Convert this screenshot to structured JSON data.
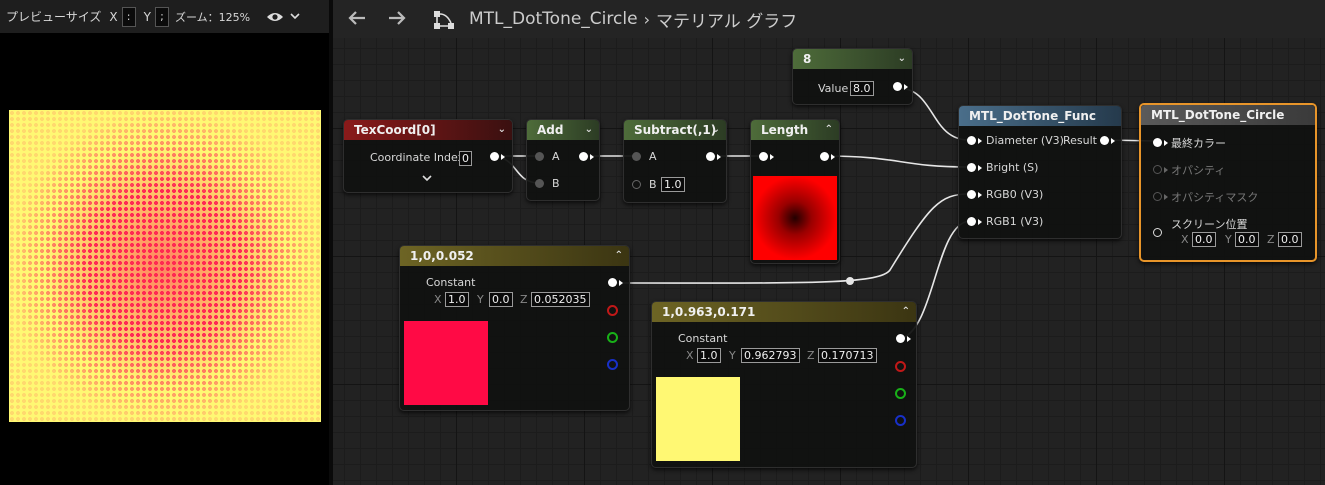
{
  "preview": {
    "label": "プレビューサイズ",
    "x_label": "X",
    "x_value": ":",
    "y_label": "Y",
    "y_value": ";",
    "zoom": "ズーム：125%"
  },
  "graph_header": {
    "asset": "MTL_DotTone_Circle",
    "separator": "›",
    "page": "マテリアル グラフ"
  },
  "nodes": {
    "texcoord": {
      "title": "TexCoord[0]",
      "label": "Coordinate Index",
      "value": "0"
    },
    "add": {
      "title": "Add",
      "pin_a": "A",
      "pin_b": "B"
    },
    "subtract": {
      "title": "Subtract(,1)",
      "pin_a": "A",
      "pin_b": "B",
      "b_value": "1.0"
    },
    "length": {
      "title": "Length"
    },
    "scalar": {
      "title": "8",
      "label": "Value",
      "value": "8.0"
    },
    "func": {
      "title": "MTL_DotTone_Func",
      "in1": "Diameter (V3)",
      "in2": "Bright (S)",
      "in3": "RGB0 (V3)",
      "in4": "RGB1 (V3)",
      "out": "Result"
    },
    "const1": {
      "title": "1,0,0.052",
      "label": "Constant",
      "x_label": "X",
      "x": "1.0",
      "y_label": "Y",
      "y": "0.0",
      "z_label": "Z",
      "z": "0.052035",
      "color": "#ff0a45"
    },
    "const2": {
      "title": "1,0.963,0.171",
      "label": "Constant",
      "x_label": "X",
      "x": "1.0",
      "y_label": "Y",
      "y": "0.962793",
      "z_label": "Z",
      "z": "0.170713",
      "color": "#fff873"
    },
    "output": {
      "title": "MTL_DotTone_Circle",
      "in1": "最終カラー",
      "in2": "オパシティ",
      "in3": "オパシティマスク",
      "in4": "スクリーン位置",
      "x_label": "X",
      "x": "0.0",
      "y_label": "Y",
      "y": "0.0",
      "z_label": "Z",
      "z": "0.0"
    }
  },
  "colors": {
    "selected_outline": "#e8952a",
    "red_channel": "#c01818",
    "green_channel": "#18b018",
    "blue_channel": "#1830c8"
  }
}
